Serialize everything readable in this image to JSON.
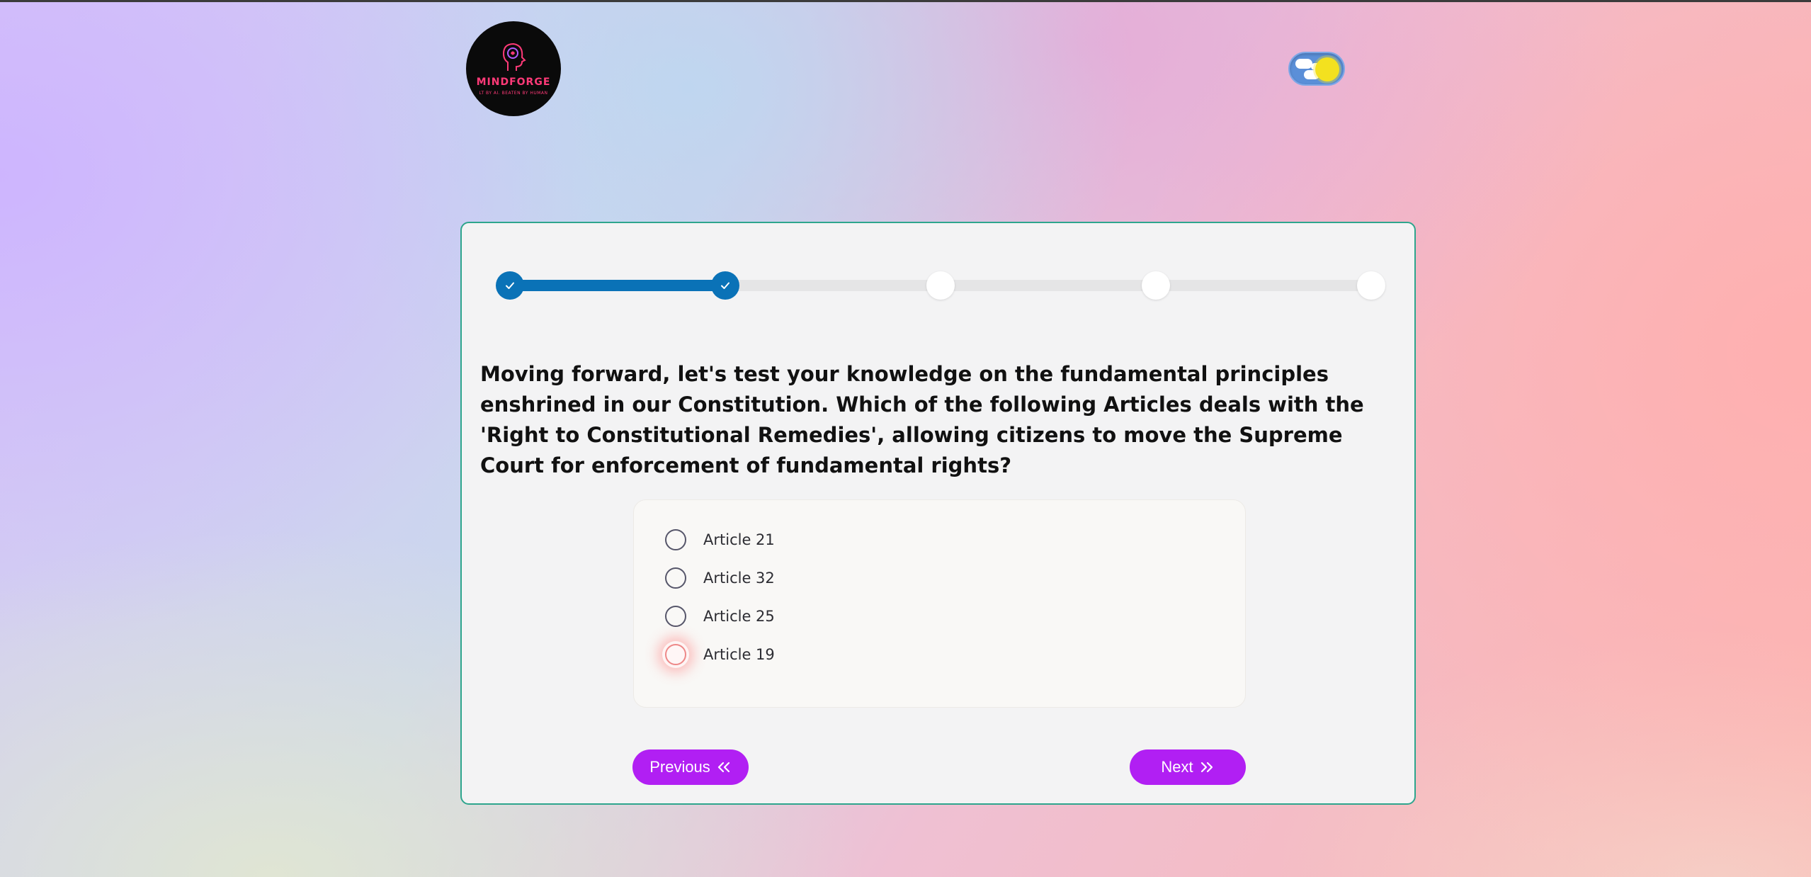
{
  "brand": {
    "name": "MINDFORGE",
    "tagline": "LT BY AI. BEATEN BY HUMAN"
  },
  "theme_toggle": {
    "mode": "light",
    "icons": [
      "cloud-icon",
      "sun-icon"
    ]
  },
  "progress": {
    "total_steps": 5,
    "completed_steps": 2,
    "fill_fraction": 0.25
  },
  "question": {
    "text": "Moving forward, let's test your knowledge on the fundamental principles enshrined in our Constitution. Which of the following Articles deals with the 'Right to Constitutional Remedies', allowing citizens to move the Supreme Court for enforcement of fundamental rights?"
  },
  "options": [
    {
      "label": "Article 21",
      "selected": false
    },
    {
      "label": "Article 32",
      "selected": false
    },
    {
      "label": "Article 25",
      "selected": false
    },
    {
      "label": "Article 19",
      "selected": false,
      "focused": true
    }
  ],
  "nav": {
    "previous_label": "Previous",
    "next_label": "Next"
  },
  "colors": {
    "progress": "#0a72b7",
    "button": "#b11ff3",
    "card_border": "#2ea58d",
    "logo_text": "#ff3a78"
  }
}
